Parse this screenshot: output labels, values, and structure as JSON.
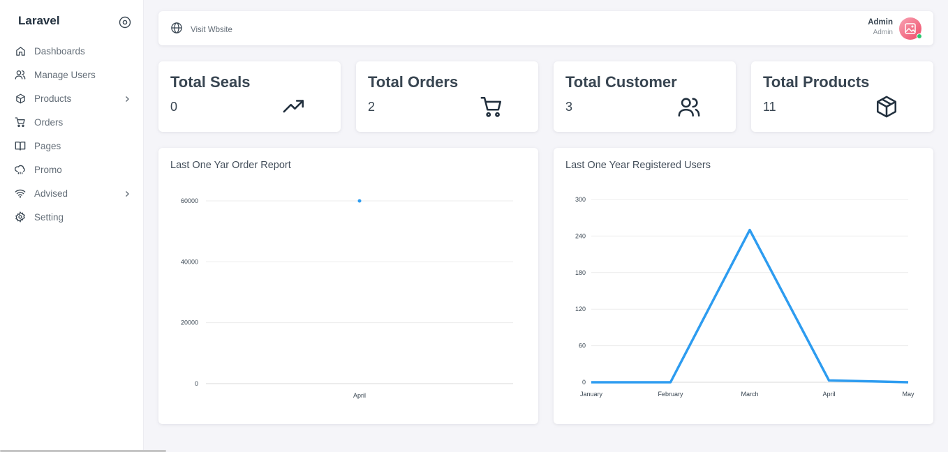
{
  "sidebar": {
    "brand": "Laravel",
    "items": [
      {
        "label": "Dashboards",
        "icon": "home-icon",
        "has_chevron": false
      },
      {
        "label": "Manage Users",
        "icon": "users-icon",
        "has_chevron": false
      },
      {
        "label": "Products",
        "icon": "box-icon",
        "has_chevron": true
      },
      {
        "label": "Orders",
        "icon": "cart-icon",
        "has_chevron": false
      },
      {
        "label": "Pages",
        "icon": "book-icon",
        "has_chevron": false
      },
      {
        "label": "Promo",
        "icon": "cloud-rain-icon",
        "has_chevron": false
      },
      {
        "label": "Advised",
        "icon": "wifi-icon",
        "has_chevron": true
      },
      {
        "label": "Setting",
        "icon": "gear-icon",
        "has_chevron": false
      }
    ]
  },
  "topbar": {
    "visit_label": "Visit Wbsite",
    "user_name": "Admin",
    "user_role": "Admin"
  },
  "stats": [
    {
      "title": "Total Seals",
      "value": "0",
      "icon": "trending-up-icon"
    },
    {
      "title": "Total Orders",
      "value": "2",
      "icon": "cart-icon"
    },
    {
      "title": "Total Customer",
      "value": "3",
      "icon": "users-icon"
    },
    {
      "title": "Total Products",
      "value": "11",
      "icon": "box-icon"
    }
  ],
  "colors": {
    "accent": "#2d9cf0",
    "status_online": "#28c76f",
    "avatar": "#ef4b68"
  },
  "chart_data": [
    {
      "type": "line",
      "title": "Last One Yar Order Report",
      "categories": [
        "April"
      ],
      "series": [
        {
          "values": [
            60000
          ]
        }
      ],
      "yticks": [
        0,
        20000,
        40000,
        60000
      ],
      "ylim": [
        0,
        60000
      ],
      "grid": true
    },
    {
      "type": "line",
      "title": "Last One Year Registered Users",
      "categories": [
        "January",
        "February",
        "March",
        "April",
        "May"
      ],
      "series": [
        {
          "values": [
            0,
            0,
            250,
            3,
            0
          ]
        }
      ],
      "yticks": [
        0,
        60,
        120,
        180,
        240,
        300
      ],
      "ylim": [
        0,
        300
      ],
      "grid": true
    }
  ]
}
